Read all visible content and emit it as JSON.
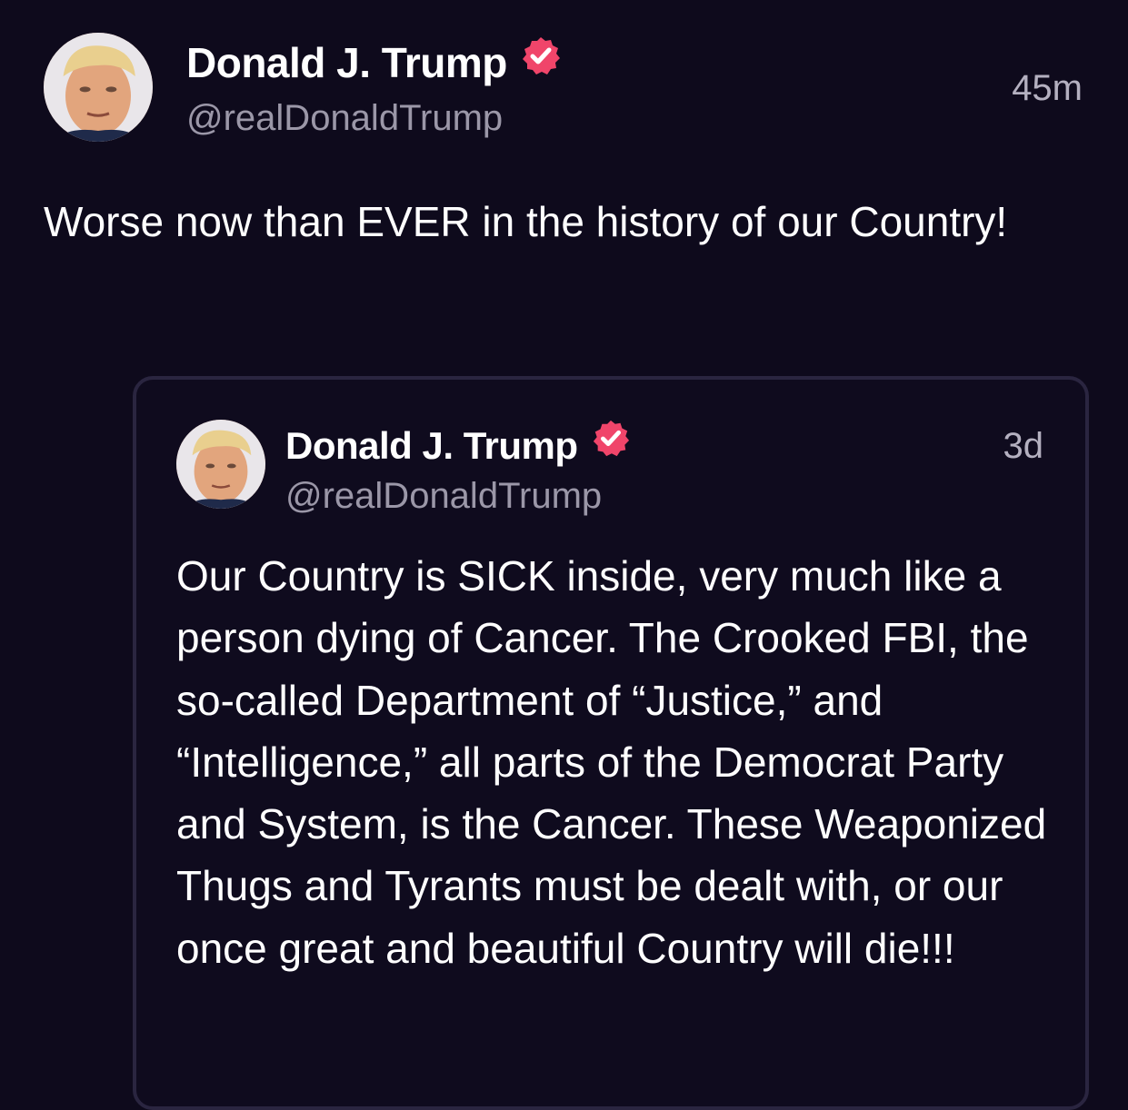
{
  "main_post": {
    "author": {
      "display_name": "Donald J. Trump",
      "handle": "@realDonaldTrump",
      "verified": true,
      "avatar_icon": "profile-photo-icon"
    },
    "timestamp": "45m",
    "body": "Worse now than EVER in the history of our Country!"
  },
  "quoted_post": {
    "author": {
      "display_name": "Donald J. Trump",
      "handle": "@realDonaldTrump",
      "verified": true,
      "avatar_icon": "profile-photo-icon"
    },
    "timestamp": "3d",
    "body": "Our Country is SICK inside, very much like a person dying of Cancer. The Crooked FBI, the so-called Department of “Justice,” and “Intelligence,” all parts of the Democrat Party and System, is the Cancer. These Weaponized Thugs and Tyrants must be dealt with, or our once great and beautiful Country will die!!!"
  },
  "colors": {
    "background": "#0e0a1c",
    "verified_badge": "#f0456a",
    "secondary_text": "#9b97a8",
    "card_border": "#2a2540"
  }
}
